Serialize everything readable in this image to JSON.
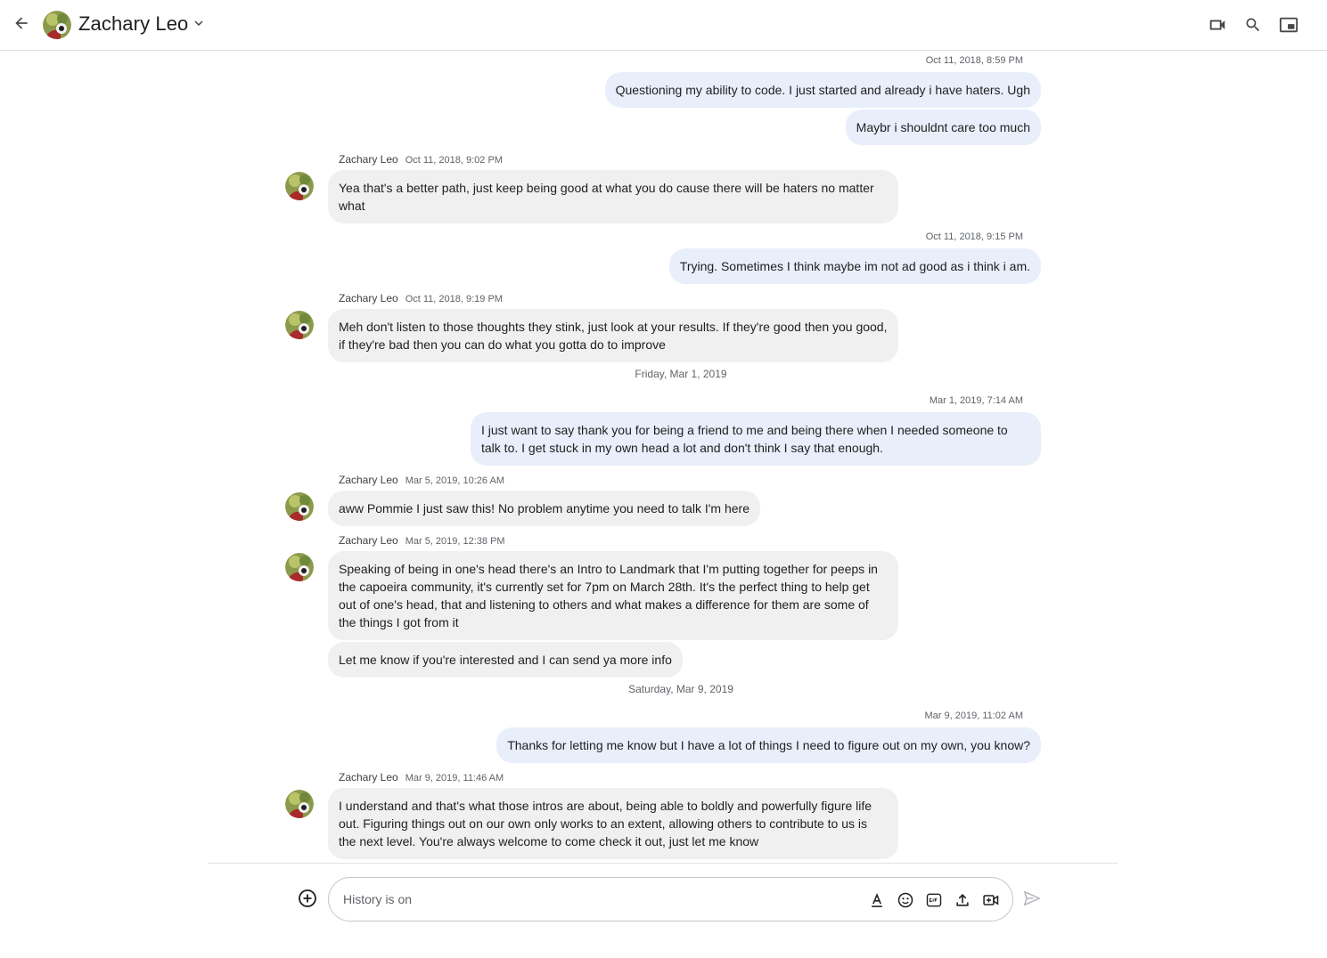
{
  "header": {
    "contact_name": "Zachary Leo",
    "icons": [
      "back-arrow-icon",
      "chevron-down-icon",
      "video-call-icon",
      "search-icon",
      "picture-in-picture-icon"
    ]
  },
  "messages": [
    {
      "type": "outgoing_timestamp",
      "text": "Oct 11, 2018, 8:59 PM"
    },
    {
      "type": "outgoing",
      "text": "Questioning my ability to code.  I just started and already i have haters. Ugh"
    },
    {
      "type": "outgoing",
      "text": "Maybr i shouldnt care too much"
    },
    {
      "type": "incoming_header",
      "sender": "Zachary Leo",
      "time": "Oct 11, 2018, 9:02 PM"
    },
    {
      "type": "incoming",
      "text": "Yea that's a better path, just keep being good at what you do cause there will be haters no matter what"
    },
    {
      "type": "outgoing_timestamp",
      "text": "Oct 11, 2018, 9:15 PM"
    },
    {
      "type": "outgoing",
      "text": "Trying. Sometimes I think maybe im not ad good as i think i am."
    },
    {
      "type": "incoming_header",
      "sender": "Zachary Leo",
      "time": "Oct 11, 2018, 9:19 PM"
    },
    {
      "type": "incoming",
      "text": "Meh don't listen to those thoughts they stink, just look at your results. If they're good then you good, if they're bad then you can do what you gotta do to improve"
    },
    {
      "type": "date_separator",
      "text": "Friday, Mar 1, 2019"
    },
    {
      "type": "outgoing_timestamp",
      "text": "Mar 1, 2019, 7:14 AM"
    },
    {
      "type": "outgoing",
      "text": "I just want to say thank you for being a friend to me and being there when I needed someone to talk to.  I get stuck in my own head a lot and don't think I say that enough."
    },
    {
      "type": "incoming_header",
      "sender": "Zachary Leo",
      "time": "Mar 5, 2019, 10:26 AM"
    },
    {
      "type": "incoming",
      "text": "aww Pommie I just saw this! No problem anytime you need to talk I'm here"
    },
    {
      "type": "incoming_header",
      "sender": "Zachary Leo",
      "time": "Mar 5, 2019, 12:38 PM"
    },
    {
      "type": "incoming",
      "text": "Speaking of being in one's head there's an Intro to Landmark that I'm putting together for peeps in the capoeira community, it's currently set for 7pm on March 28th. It's the perfect thing to help get out of one's head, that and listening to others and what makes a difference for them are some of the things I got from it"
    },
    {
      "type": "incoming",
      "text": "Let me know if you're interested and I can send ya more info"
    },
    {
      "type": "date_separator",
      "text": "Saturday, Mar 9, 2019"
    },
    {
      "type": "outgoing_timestamp",
      "text": "Mar 9, 2019, 11:02 AM"
    },
    {
      "type": "outgoing",
      "text": "Thanks for letting me know but I have a lot of things I need to figure out on my own, you know?"
    },
    {
      "type": "incoming_header",
      "sender": "Zachary Leo",
      "time": "Mar 9, 2019, 11:46 AM"
    },
    {
      "type": "incoming",
      "text": "I understand and that's what those intros are about, being able to boldly and powerfully figure life out. Figuring things out on our own only works to an extent, allowing others to contribute to us is the next level. You're always welcome to come check it out, just let me know"
    }
  ],
  "composer": {
    "placeholder": "History is on",
    "value": "",
    "icons": [
      "add-circle-icon",
      "text-format-icon",
      "emoji-icon",
      "gif-icon",
      "upload-icon",
      "video-meeting-icon",
      "send-icon"
    ]
  },
  "colors": {
    "outgoing_bubble": "#e9eefb",
    "incoming_bubble": "#f0f0f0",
    "secondary_text": "#5f6368"
  }
}
